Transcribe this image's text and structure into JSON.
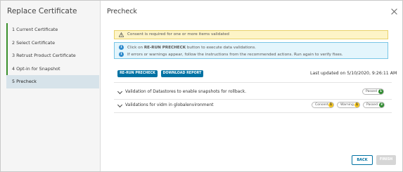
{
  "sidebar": {
    "title": "Replace Certificate",
    "steps": [
      {
        "label": "1 Current Certificate",
        "state": "done"
      },
      {
        "label": "2 Select Certificate",
        "state": "done"
      },
      {
        "label": "3 Retrust Product Certificate",
        "state": "done"
      },
      {
        "label": "4 Opt-in for Snapshot",
        "state": "done"
      },
      {
        "label": "5 Precheck",
        "state": "active"
      }
    ]
  },
  "main": {
    "title": "Precheck",
    "alerts": {
      "warning": "Consent is required for one or more items validated",
      "info_line1_prefix": "Click on ",
      "info_line1_bold": "RE-RUN PRECHECK",
      "info_line1_suffix": " button to execute data validations.",
      "info_line2": "If errors or warnings appear, follow the instructions from the recommended actions. Run again to verify fixes."
    },
    "buttons": {
      "rerun": "RE-RUN PRECHECK",
      "download": "DOWNLOAD REPORT"
    },
    "last_updated_label": "Last updated on",
    "last_updated_value": "5/10/2020, 9:26:11 AM",
    "validations": [
      {
        "label": "Validation of Datastores to enable snapshots for rollback.",
        "badges": [
          {
            "label": "Passed",
            "count": "1",
            "color": "#2e8a2e"
          }
        ]
      },
      {
        "label": "Validations for vidm in globalenvironment",
        "badges": [
          {
            "label": "Consent",
            "count": "1",
            "color": "#efc220"
          },
          {
            "label": "Warning",
            "count": "1",
            "color": "#efc220"
          },
          {
            "label": "Passed",
            "count": "3",
            "color": "#2e8a2e"
          }
        ]
      }
    ]
  },
  "footer": {
    "back": "BACK",
    "finish": "FINISH"
  },
  "colors": {
    "primary": "#0072a3",
    "done_step": "#3a8f2c",
    "warning_bg": "#fdf4c7",
    "info_bg": "#e3f5fc"
  },
  "icons": {
    "close": "close-icon",
    "warning": "warning-triangle-icon",
    "info": "info-circle-icon",
    "expand": "chevron-down-icon"
  }
}
